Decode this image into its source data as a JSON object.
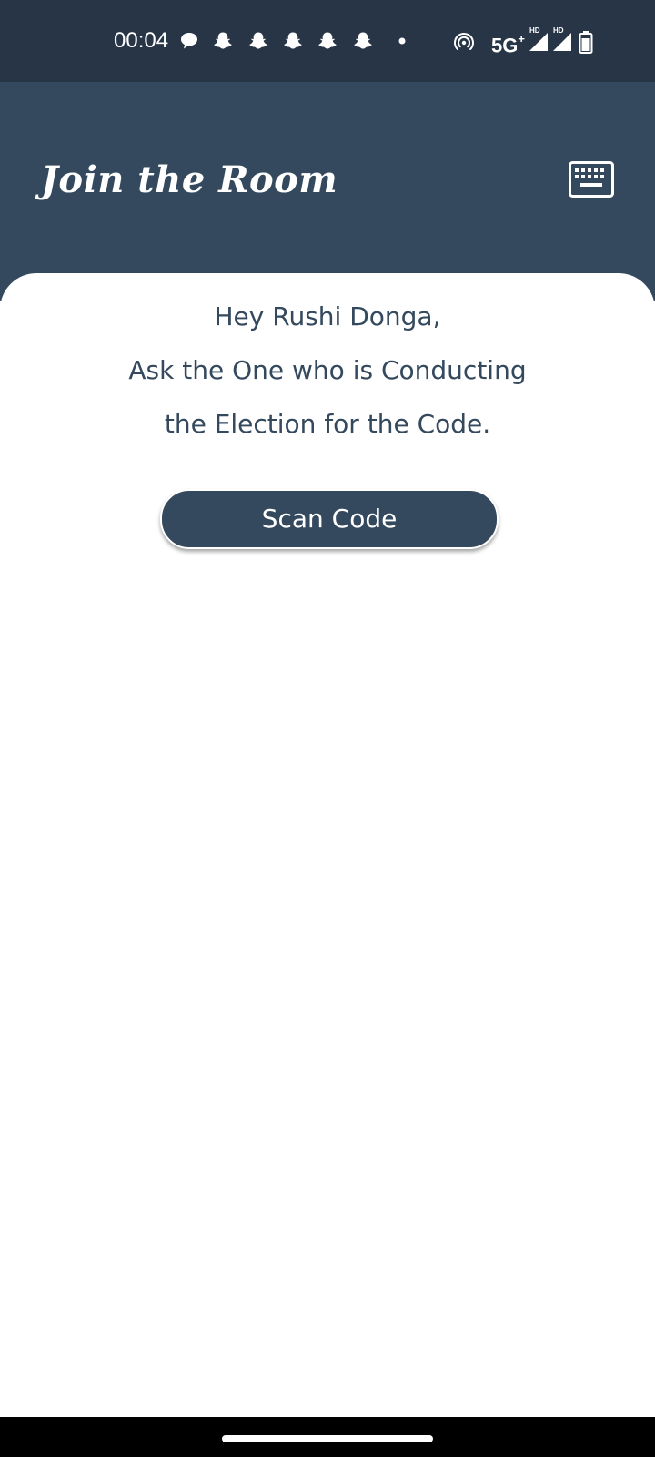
{
  "status_bar": {
    "time": "00:04",
    "network": "5G",
    "network_suffix": "+",
    "sim1_badge": "HD",
    "sim2_badge": "HD",
    "background": "#273547",
    "icons": [
      "chat-bubble-icon",
      "snapchat-icon",
      "snapchat-icon",
      "snapchat-icon",
      "snapchat-icon",
      "snapchat-icon",
      "notification-dot-icon",
      "hotspot-icon",
      "signal-icon",
      "signal-icon",
      "battery-icon"
    ]
  },
  "header": {
    "title": "Join the Room",
    "action_icon": "keyboard-icon",
    "background": "#34495e"
  },
  "main": {
    "greeting": "Hey Rushi Donga,",
    "instruction_line1": "Ask the One who is Conducting",
    "instruction_line2": "the Election for the Code.",
    "scan_button_label": "Scan Code",
    "text_color": "#34495e"
  },
  "nav_bar": {
    "home_indicator": "home-indicator",
    "background": "#000000"
  }
}
